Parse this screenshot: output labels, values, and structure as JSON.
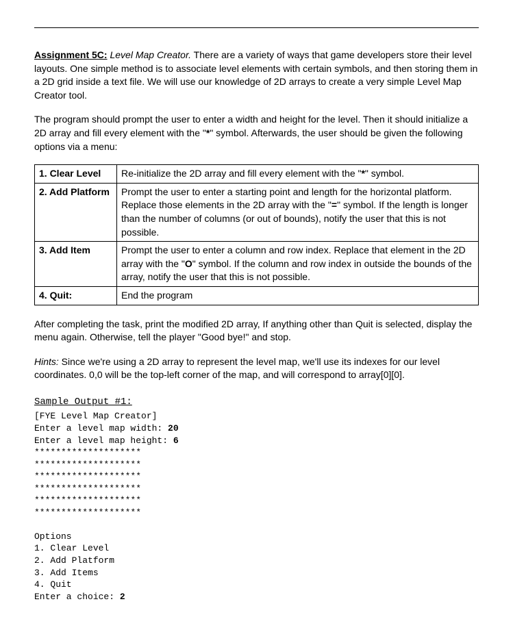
{
  "header": {
    "assignment_label": "Assignment 5C:",
    "assignment_name": " Level Map Creator."
  },
  "intro": {
    "p1_part1": " There are a variety of ways that game developers store their level layouts. One simple method is to associate level elements with certain symbols, and then storing them in a 2D grid inside a text file. We will use our knowledge of 2D arrays to create a very simple Level Map Creator tool.",
    "p2_a": "The program should prompt the user to enter a width and height for the level. Then it should initialize a 2D array and fill every element with the \"",
    "p2_star": "*",
    "p2_b": "\" symbol. Afterwards, the user should be given the following options via a menu:"
  },
  "table": {
    "rows": [
      {
        "label": "1. Clear Level",
        "desc_a": "Re-initialize the 2D array and fill every element with the \"",
        "sym": "*",
        "desc_b": "\" symbol."
      },
      {
        "label": "2. Add Platform",
        "desc_a": "Prompt the user to enter a starting point and length for the horizontal platform. Replace those elements in the 2D array with the \"",
        "sym": "=",
        "desc_b": "\" symbol. If the length is longer than the number of columns (or out of bounds), notify the user that this is not possible."
      },
      {
        "label": "3. Add Item",
        "desc_a": "Prompt the user to enter a column and row index. Replace that element in the 2D array with the \"",
        "sym": "O",
        "desc_b": "\" symbol. If the column and row index in outside the bounds of the array, notify the user that this is not possible."
      },
      {
        "label": "4. Quit:",
        "desc_a": "End the program",
        "sym": "",
        "desc_b": ""
      }
    ]
  },
  "after_table": {
    "p3": "After completing the task, print the modified 2D array, If anything other than Quit is selected, display the menu again. Otherwise, tell the player \"Good bye!\" and stop.",
    "hints_label": "Hints:",
    "hints_body": " Since we're using a 2D array to represent the level map, we'll use its indexes for our level coordinates. 0,0 will be the top-left corner of the map, and will correspond to array[0][0]."
  },
  "sample": {
    "heading": "Sample Output #1:",
    "line1": "[FYE Level Map Creator]",
    "line2a": "Enter a level map width: ",
    "line2b": "20",
    "line3a": "Enter a level map height: ",
    "line3b": "6",
    "stars": "********************",
    "opts_header": "Options",
    "opt1": "1. Clear Level",
    "opt2": "2. Add Platform",
    "opt3": "3. Add Items",
    "opt4": "4. Quit",
    "choice_a": "Enter a choice: ",
    "choice_b": "2"
  }
}
